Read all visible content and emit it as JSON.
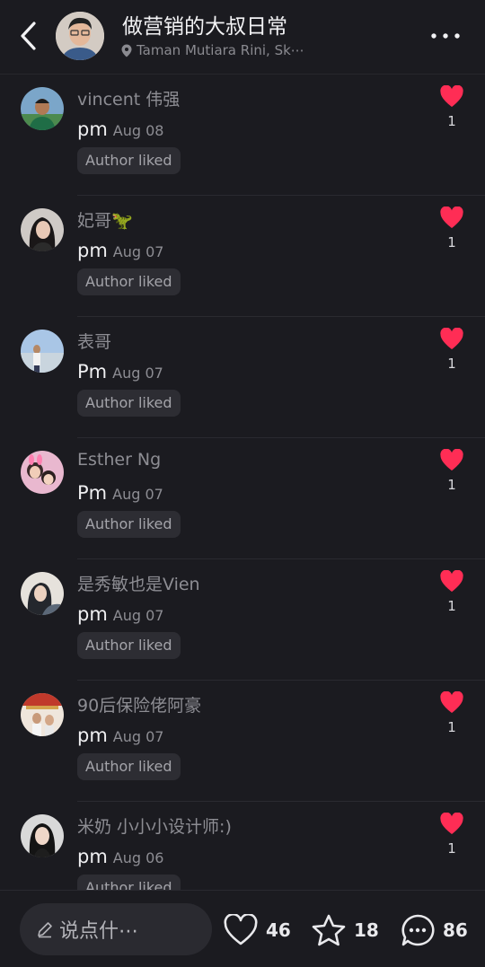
{
  "header": {
    "title": "做营销的大叔日常",
    "location": "Taman Mutiara Rini, Sk⋯"
  },
  "rows": [
    {
      "name": "vincent 伟强",
      "text": "pm",
      "date": "Aug 08",
      "badge": "Author liked",
      "likes": "1"
    },
    {
      "name": "妃哥🦖",
      "text": "pm",
      "date": "Aug 07",
      "badge": "Author liked",
      "likes": "1"
    },
    {
      "name": "表哥",
      "text": "Pm",
      "date": "Aug 07",
      "badge": "Author liked",
      "likes": "1"
    },
    {
      "name": "Esther Ng",
      "text": "Pm",
      "date": "Aug 07",
      "badge": "Author liked",
      "likes": "1"
    },
    {
      "name": "是秀敏也是Vien",
      "text": "pm",
      "date": "Aug 07",
      "badge": "Author liked",
      "likes": "1"
    },
    {
      "name": "90后保险佬阿豪",
      "text": "pm",
      "date": "Aug 07",
      "badge": "Author liked",
      "likes": "1"
    },
    {
      "name": "米奶 小小小设计师:)",
      "text": "pm",
      "date": "Aug 06",
      "badge": "Author liked",
      "likes": "1"
    }
  ],
  "bottom": {
    "comment_placeholder": "说点什⋯",
    "likes": "46",
    "stars": "18",
    "comments": "86"
  },
  "colors": {
    "background": "#1b1b20",
    "heart": "#ff2d55",
    "badge_bg": "#2d2d33"
  }
}
